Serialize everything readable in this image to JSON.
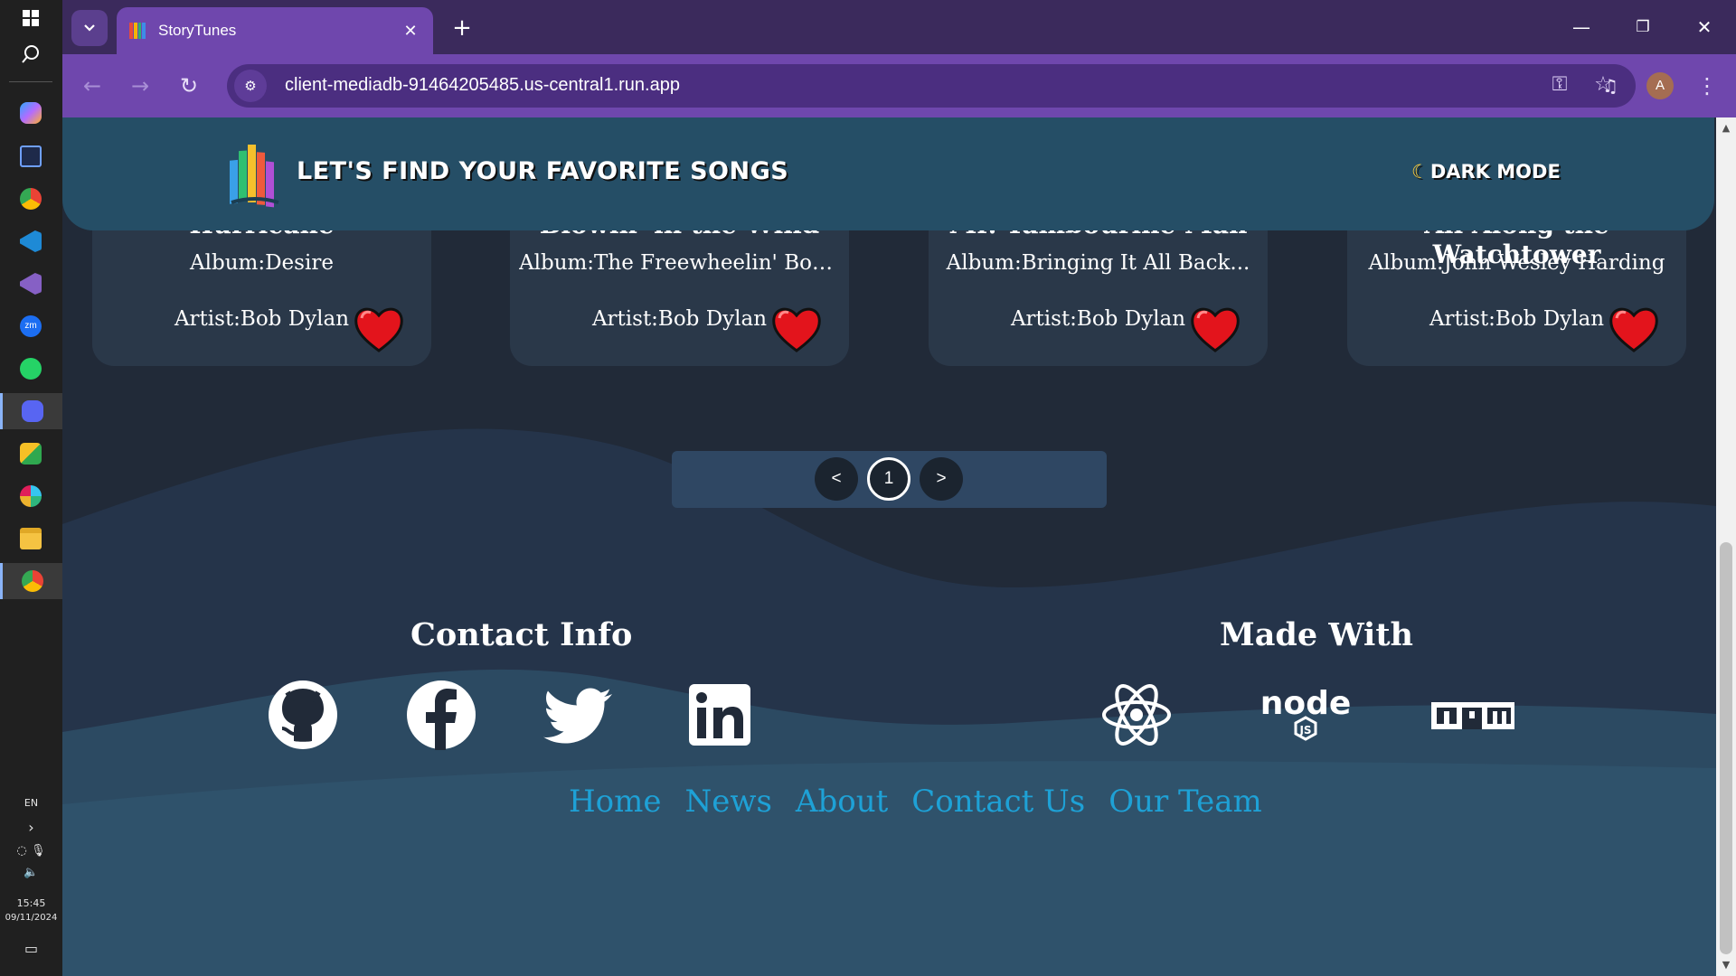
{
  "taskbar": {
    "language": "EN",
    "time": "15:45",
    "date": "09/11/2024"
  },
  "browser": {
    "tab_title": "StoryTunes",
    "url": "client-mediadb-91464205485.us-central1.run.app",
    "profile_initial": "A"
  },
  "site": {
    "title": "LET'S FIND YOUR FAVORITE SONGS",
    "dark_mode_label": "DARK MODE"
  },
  "songs": [
    {
      "title": "Hurricane",
      "album": "Album:Desire",
      "artist": "Artist:Bob Dylan"
    },
    {
      "title": "Blowin' in the Wind",
      "album": "Album:The Freewheelin' Bob...",
      "artist": "Artist:Bob Dylan"
    },
    {
      "title": "Mr. Tambourine Man",
      "album": "Album:Bringing It All Back...",
      "artist": "Artist:Bob Dylan"
    },
    {
      "title": "All Along the Watchtower",
      "album": "Album:John Wesley Harding",
      "artist": "Artist:Bob Dylan"
    }
  ],
  "pagination": {
    "prev": "<",
    "current": "1",
    "next": ">"
  },
  "footer": {
    "contact_heading": "Contact Info",
    "made_with_heading": "Made With",
    "links": [
      "Home",
      "News",
      "About",
      "Contact Us",
      "Our Team"
    ]
  },
  "colors": {
    "header_bg": "#254e66",
    "card_bg": "#2a3849",
    "heart": "#e3141c",
    "link": "#1ea1d6",
    "browser_accent": "#6f47ad"
  }
}
